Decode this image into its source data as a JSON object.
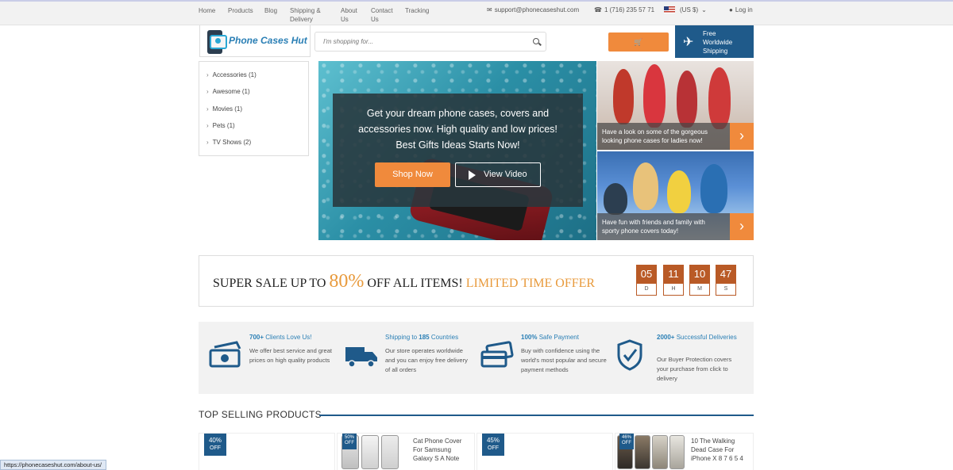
{
  "nav": {
    "links": [
      "Home",
      "Products",
      "Blog",
      "Shipping & Delivery",
      "About Us",
      "Contact Us",
      "Tracking"
    ],
    "email": "support@phonecaseshut.com",
    "phone": "1 (716) 235 57 71",
    "currency": "(US $)",
    "login": "Log in"
  },
  "header": {
    "logo_text": "Phone Cases Hut",
    "search_placeholder": "I'm shopping for...",
    "shipping_line1": "Free",
    "shipping_line2": "Worldwide",
    "shipping_line3": "Shipping"
  },
  "sidebar": {
    "categories": [
      "Accessories (1)",
      "Awesome (1)",
      "Movies (1)",
      "Pets (1)",
      "TV Shows (2)"
    ]
  },
  "hero": {
    "line1": "Get your dream phone cases, covers and",
    "line2": "accessories now. High quality and low prices!",
    "line3": "Best Gifts Ideas Starts Now!",
    "shop_label": "Shop Now",
    "video_label": "View Video"
  },
  "promos": [
    {
      "caption_line1": "Have a look on some of the gorgeous",
      "caption_line2": "looking phone cases for ladies now!"
    },
    {
      "caption_line1": "Have fun with friends and family with",
      "caption_line2": "sporty phone covers today!"
    }
  ],
  "sale": {
    "prefix": "SUPER SALE UP TO ",
    "percent": "80%",
    "middle": " OFF ALL ITEMS! ",
    "limited": "LIMITED TIME OFFER",
    "timer": [
      {
        "value": "05",
        "label": "D"
      },
      {
        "value": "11",
        "label": "H"
      },
      {
        "value": "10",
        "label": "M"
      },
      {
        "value": "47",
        "label": "S"
      }
    ]
  },
  "features": [
    {
      "title_bold": "700+",
      "title_rest": " Clients Love Us!",
      "desc": "We offer best service and great prices on high quality products"
    },
    {
      "title_pre": "Shipping to ",
      "title_bold": "185",
      "title_rest": " Countries",
      "desc": "Our store operates worldwide and you can enjoy free delivery of all orders"
    },
    {
      "title_bold": "100%",
      "title_rest": " Safe Payment",
      "desc": "Buy with confidence using the world's most popular and secure payment methods"
    },
    {
      "title_bold": "2000+",
      "title_rest": " Successful Deliveries",
      "desc": "Our Buyer Protection covers your purchase from click to delivery"
    }
  ],
  "top_selling": {
    "heading": "TOP SELLING PRODUCTS",
    "products": [
      {
        "badge": "40%",
        "off": "OFF"
      },
      {
        "badge": "50%",
        "off": "OFF",
        "name_line1": "Cat Phone Cover",
        "name_line2": "For Samsung",
        "name_line3": "Galaxy S A Note"
      },
      {
        "badge": "45%",
        "off": "OFF"
      },
      {
        "badge": "46%",
        "off": "OFF",
        "name_line1": "10 The Walking",
        "name_line2": "Dead Case For",
        "name_line3": "iPhone X 8 7 6 5 4"
      }
    ]
  },
  "statusbar": {
    "url": "https://phonecaseshut.com/about-us/"
  },
  "colors": {
    "accent": "#f08a3c",
    "brand": "#1f5a8a",
    "timer": "#b95a26"
  }
}
